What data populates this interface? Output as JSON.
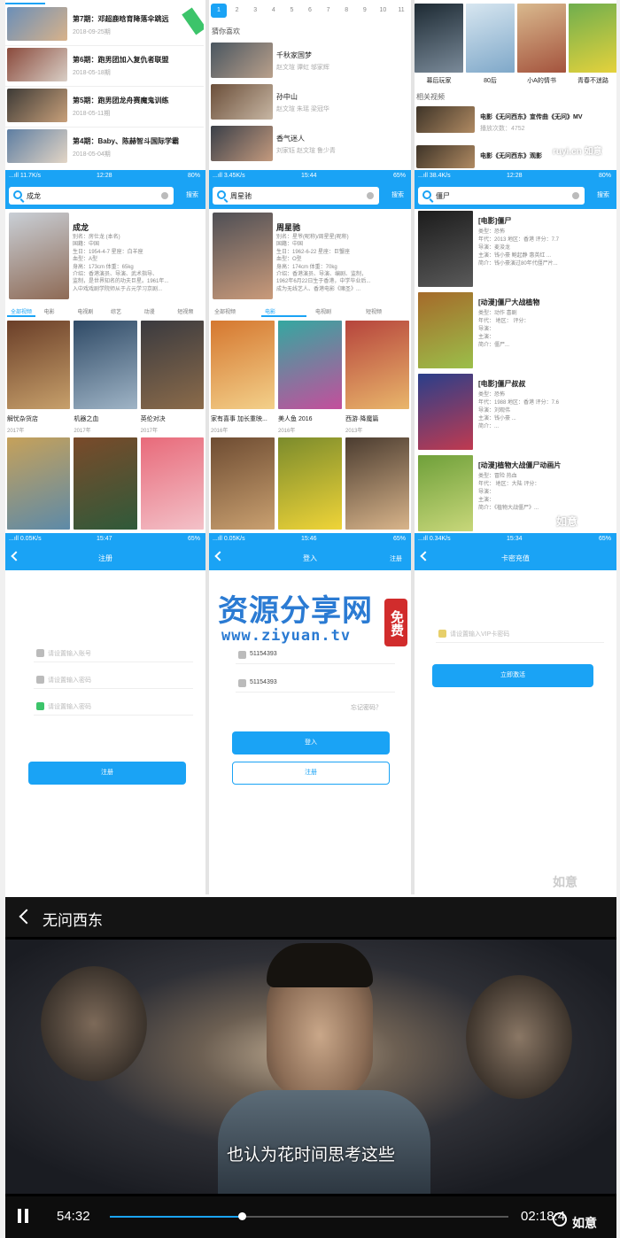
{
  "col1_top": {
    "items": [
      {
        "title": "第7期：邓超鹿晗育降落伞跳远",
        "date": "2018-09-25期",
        "c1": "#6b8fb8",
        "c2": "#d8b28a"
      },
      {
        "title": "第6期：跑男团加入复仇者联盟",
        "date": "2018-05-18期",
        "c1": "#8a4a3c",
        "c2": "#d9cfc6"
      },
      {
        "title": "第5期：跑男团龙舟赛魔鬼训练",
        "date": "2018-05-11期",
        "c1": "#3d3a36",
        "c2": "#c8a07a"
      },
      {
        "title": "第4期：Baby、陈赫智斗国际学霸",
        "date": "2018-05-04期",
        "c1": "#5e7ea2",
        "c2": "#e3d5c5"
      }
    ]
  },
  "col2_top": {
    "pages": [
      "1",
      "2",
      "3",
      "4",
      "5",
      "6",
      "7",
      "8",
      "9",
      "10",
      "11"
    ],
    "section_title": "猜你喜欢",
    "items": [
      {
        "title": "千秋家国梦",
        "sub": "赵文瑄 谭虹 邬家辉",
        "c1": "#4a5660",
        "c2": "#b9a08b"
      },
      {
        "title": "孙中山",
        "sub": "赵文瑄 朱瑶 梁冠华",
        "c1": "#6b4f3a",
        "c2": "#c7b6a3"
      },
      {
        "title": "香气迷人",
        "sub": "刘家钰 赵文瑄 鲁少青",
        "c1": "#3a3f48",
        "c2": "#c49a7e"
      }
    ]
  },
  "col3_top": {
    "posters": [
      {
        "label": "幕后玩家",
        "c1": "#1d2a33",
        "c2": "#7a8a99"
      },
      {
        "label": "80后",
        "c1": "#d7e6f0",
        "c2": "#7fa8c9"
      },
      {
        "label": "小A的情书",
        "c1": "#d9b98e",
        "c2": "#a4533d"
      },
      {
        "label": "青春不迷路",
        "c1": "#6fae4e",
        "c2": "#e5d23c"
      }
    ],
    "section_title": "相关视频",
    "related": [
      {
        "title": "电影《无问西东》宣传曲《无问》MV",
        "sub": "播放次数：4752"
      },
      {
        "title": "电影《无问西东》观影"
      }
    ]
  },
  "search_panels": [
    {
      "status_left": "...ıll 11.7K/s",
      "status_time": "12:28",
      "status_right": "80%",
      "query": "成龙",
      "search_btn": "搜索",
      "name": "成龙",
      "meta": [
        "别名：房仕龙 (本名)",
        "国籍：中国",
        "生日：1954-4-7  星座：白羊座",
        "血型：A型",
        "身高：173cm  体重：65kg",
        "介绍：香港演员、导演、武术指导、",
        "监制，是世界知名的功夫巨星。1961年...",
        "入中戏戏剧学院师从于占元学习京剧..."
      ],
      "tabs": [
        "全部视频",
        "电影",
        "电视剧",
        "综艺",
        "动漫",
        "短视频"
      ],
      "active_tab": 0,
      "posters": [
        {
          "title": "解忧杂货店",
          "year": "2017年",
          "c1": "#6a3e28",
          "c2": "#c7a06b"
        },
        {
          "title": "机器之血",
          "year": "2017年",
          "c1": "#2f4a66",
          "c2": "#9fb4c6"
        },
        {
          "title": "英伦对决",
          "year": "2017年",
          "c1": "#3a3a3f",
          "c2": "#8b6b4a"
        },
        {
          "title": "",
          "year": "",
          "c1": "#c6a15a",
          "c2": "#5d8aa8"
        },
        {
          "title": "",
          "year": "",
          "c1": "#7a4a2a",
          "c2": "#2f5a3a"
        },
        {
          "title": "",
          "year": "",
          "c1": "#e86a7a",
          "c2": "#f3c1c8"
        }
      ],
      "portrait": {
        "c1": "#c9cfd6",
        "c2": "#8e6a55"
      }
    },
    {
      "status_left": "...ıll 3.45K/s",
      "status_time": "15:44",
      "status_right": "65%",
      "query": "周星驰",
      "search_btn": "搜索",
      "name": "周星驰",
      "meta": [
        "别名：星爷(昵称)/周星星(昵称)",
        "国籍：中国",
        "生日：1962-6-22  星座：巨蟹座",
        "血型：O型",
        "身高：174cm  体重：70kg",
        "介绍：香港演员、导演、编剧、监制，",
        "1962年6月22日生于香港，中学毕业后...",
        "成为无线艺人、香港电影《赌圣》..."
      ],
      "tabs": [
        "全部视频",
        "电影",
        "电视剧",
        "短视频"
      ],
      "active_tab": 1,
      "posters": [
        {
          "title": "家有喜事 加长重映...",
          "year": "2016年",
          "c1": "#d5772f",
          "c2": "#f3d08a"
        },
        {
          "title": "美人鱼 2016",
          "year": "2016年",
          "c1": "#34a8a0",
          "c2": "#c44e9c"
        },
        {
          "title": "西游·降魔篇",
          "year": "2013年",
          "c1": "#b6443c",
          "c2": "#e9b66b"
        },
        {
          "title": "",
          "year": "",
          "c1": "#6e4c32",
          "c2": "#c9a070"
        },
        {
          "title": "",
          "year": "",
          "c1": "#7b8b2c",
          "c2": "#efd438"
        },
        {
          "title": "",
          "year": "",
          "c1": "#4b3c30",
          "c2": "#d8b48a"
        }
      ],
      "portrait": {
        "c1": "#4f4f55",
        "c2": "#c99a7a"
      }
    },
    {
      "status_left": "...ıll 38.4K/s",
      "status_time": "12:28",
      "status_right": "80%",
      "query": "僵尸",
      "search_btn": "搜索",
      "results": [
        {
          "title": "[电影]僵尸",
          "meta": [
            "类型：恐怖",
            "年代：2013  地区：香港  评分：7.7",
            "导演：麦浚龙",
            "主演：钱小豪 鲍起静 惠英红 ...",
            "简介：钱小豪演过80年代僵尸片..."
          ],
          "c1": "#1c1c1c",
          "c2": "#5a5a5a"
        },
        {
          "title": "[动漫]僵尸大战植物",
          "meta": [
            "类型：动作 喜剧",
            "年代：  地区：  评分：",
            "导演：",
            "主演：",
            "简介：僵尸..."
          ],
          "c1": "#a56a2a",
          "c2": "#9bbf4a"
        },
        {
          "title": "[电影]僵尸叔叔",
          "meta": [
            "类型：恐怖",
            "年代：1988  地区：香港  评分：7.6",
            "导演：刘观伟",
            "主演：钱小豪 ...",
            "简介：..."
          ],
          "c1": "#2a3f8a",
          "c2": "#c03a50"
        },
        {
          "title": "[动漫]植物大战僵尸动画片",
          "meta": [
            "类型：冒险 热血",
            "年代：  地区：大陆  评分：",
            "导演：",
            "主演：",
            "简介：《植物大战僵尸》..."
          ],
          "c1": "#6fa03a",
          "c2": "#c8d77a"
        }
      ]
    }
  ],
  "form_panels": [
    {
      "status_left": "...ıll 0.05K/s",
      "status_time": "15:47",
      "status_right": "65%",
      "title": "注册",
      "fields": [
        "请设置输入账号",
        "请设置输入密码",
        "请设置输入密码"
      ],
      "primary_btn": "注册"
    },
    {
      "status_left": "...ıll 0.05K/s",
      "status_time": "15:46",
      "status_right": "65%",
      "title": "登入",
      "right": "注册",
      "fields": [
        "51154393",
        "51154393"
      ],
      "forgot": "忘记密码？",
      "primary_btn": "登入",
      "secondary_btn": "注册"
    },
    {
      "status_left": "...ıll 0.34K/s",
      "status_time": "15:34",
      "status_right": "65%",
      "title": "卡密充值",
      "fields": [
        "请设置输入VIP卡密码"
      ],
      "primary_btn": "立即激活"
    }
  ],
  "watermark": {
    "main": "资源分享网",
    "sub": "www.ziyuan.tv",
    "badge": "免费"
  },
  "corner_marks": {
    "c1": "ruyi.cn 如意",
    "c2": "如意",
    "c3": "如意",
    "c4": "如意"
  },
  "player": {
    "title": "无问西东",
    "subtitle": "也认为花时间思考这些",
    "elapsed": "54:32",
    "total": "02:18:4",
    "progress": 0.33,
    "logo": "如意"
  }
}
